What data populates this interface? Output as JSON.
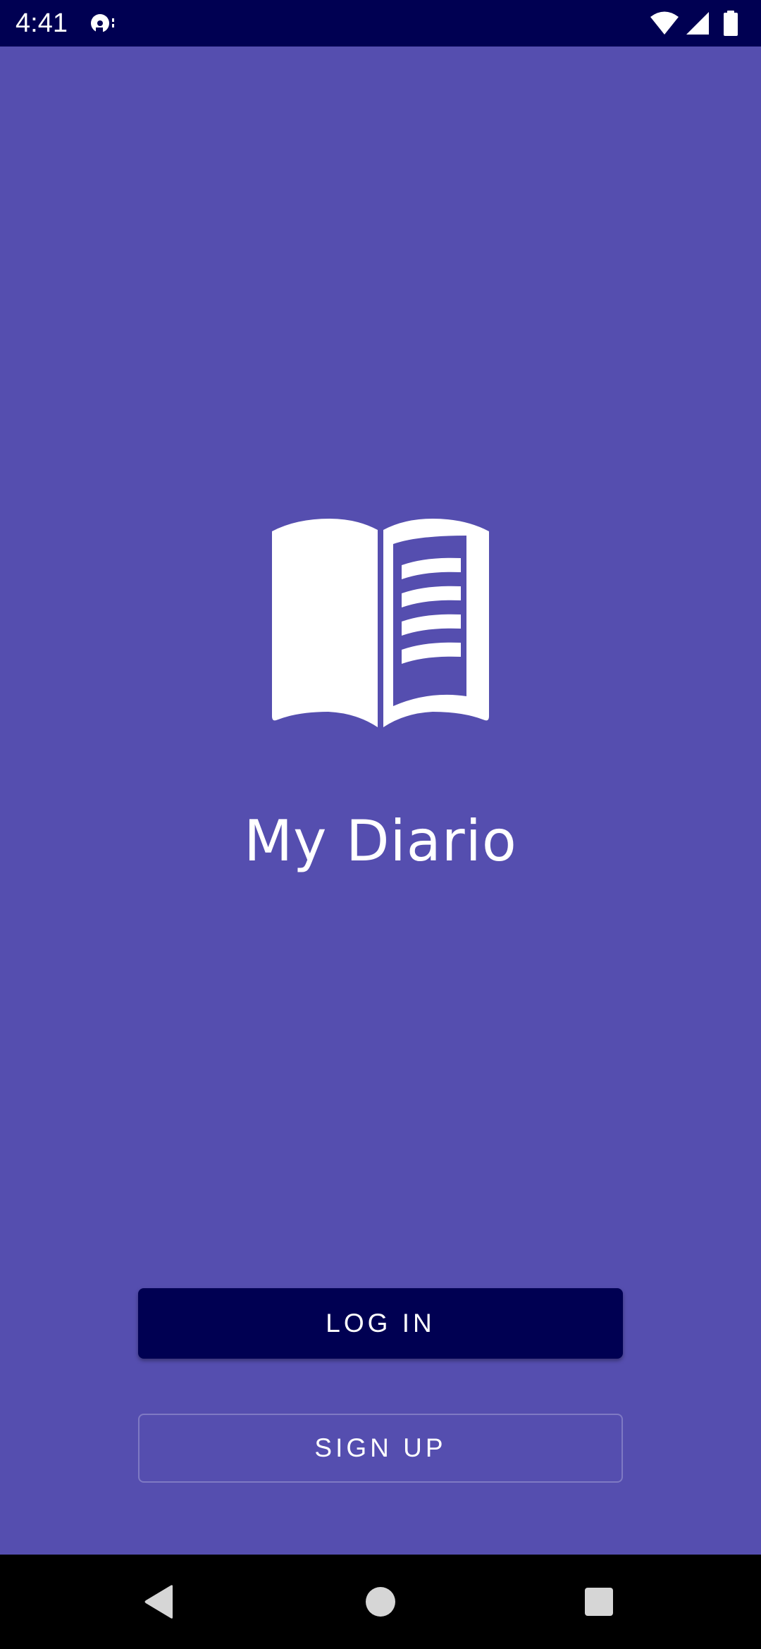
{
  "status_bar": {
    "time": "4:41",
    "icons": [
      "media-cast-icon",
      "wifi-icon",
      "cellular-signal-icon",
      "battery-icon"
    ]
  },
  "app": {
    "title": "My Diario",
    "logo_icon": "open-book-icon"
  },
  "actions": {
    "login_label": "LOG IN",
    "signup_label": "SIGN UP"
  },
  "nav_bar": {
    "icons": [
      "back-icon",
      "home-icon",
      "recents-icon"
    ]
  },
  "colors": {
    "background": "#554EAF",
    "status_bar": "#000052",
    "primary_button": "#000052",
    "text": "#FFFFFF",
    "nav_bar": "#000000"
  }
}
